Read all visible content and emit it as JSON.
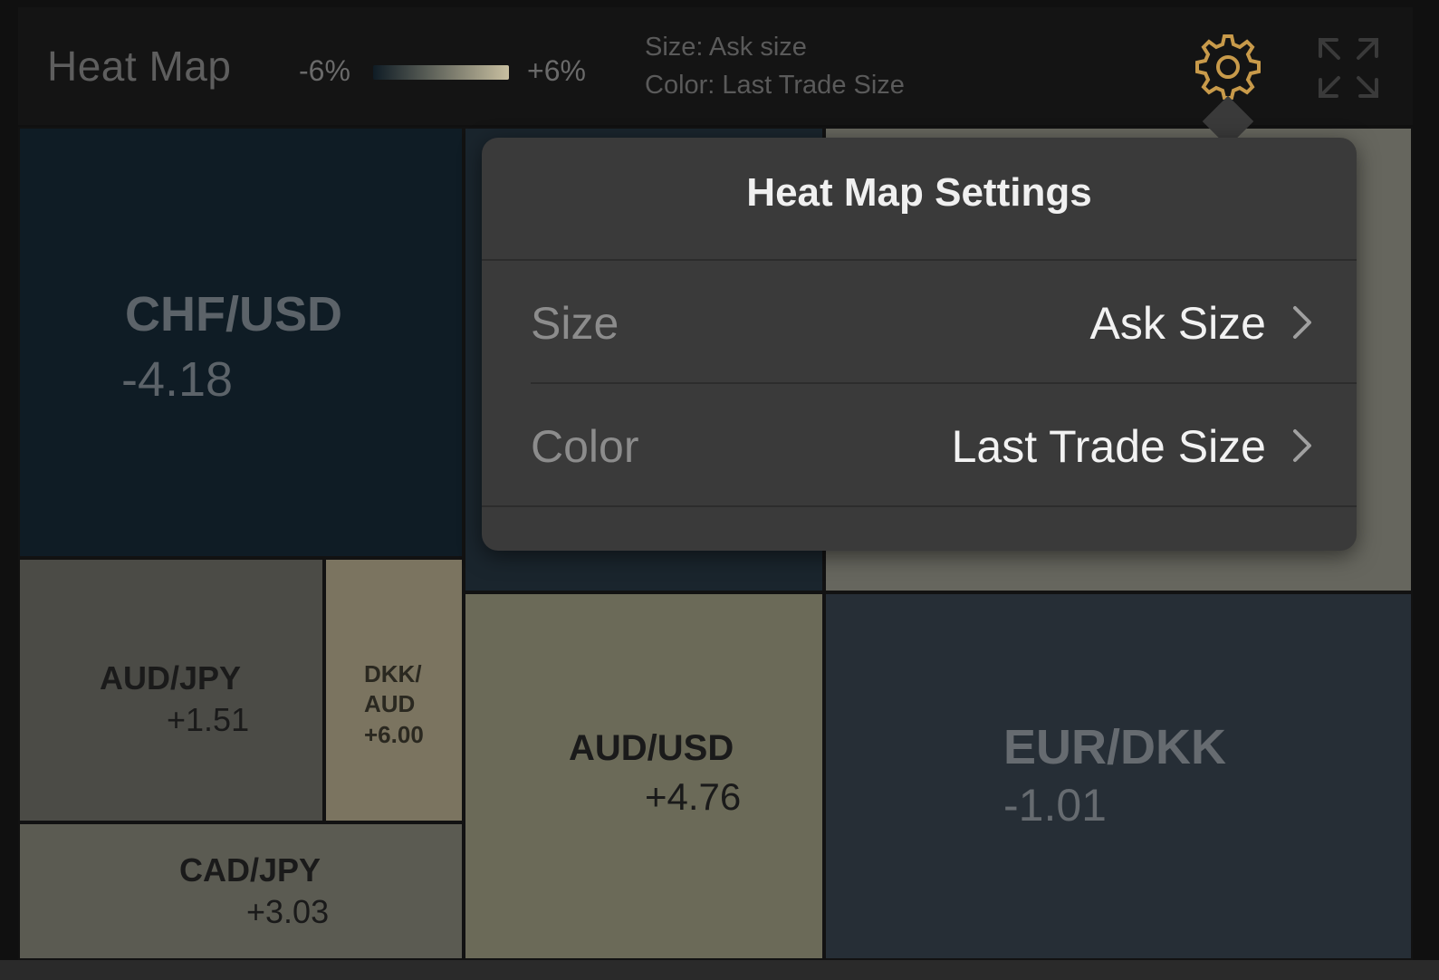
{
  "header": {
    "title": "Heat Map",
    "scale_min": "-6%",
    "scale_max": "+6%",
    "legend_size": "Size: Ask size",
    "legend_color": "Color: Last Trade Size",
    "gradient_start": "#0f1c25",
    "gradient_end": "#c8bfa0",
    "gear_color": "#c89a4a"
  },
  "tiles": {
    "chf_usd": {
      "symbol": "CHF/USD",
      "value": "-4.18"
    },
    "aud_jpy": {
      "symbol": "AUD/JPY",
      "value": "+1.51"
    },
    "dkk_aud": {
      "symbol_line1": "DKK/",
      "symbol_line2": "AUD",
      "value": "+6.00"
    },
    "cad_jpy": {
      "symbol": "CAD/JPY",
      "value": "+3.03"
    },
    "aud_usd": {
      "symbol": "AUD/USD",
      "value": "+4.76"
    },
    "eur_dkk": {
      "symbol": "EUR/DKK",
      "value": "-1.01"
    }
  },
  "settings_popover": {
    "title": "Heat Map Settings",
    "rows": [
      {
        "label": "Size",
        "value": "Ask Size"
      },
      {
        "label": "Color",
        "value": "Last Trade Size"
      }
    ]
  }
}
